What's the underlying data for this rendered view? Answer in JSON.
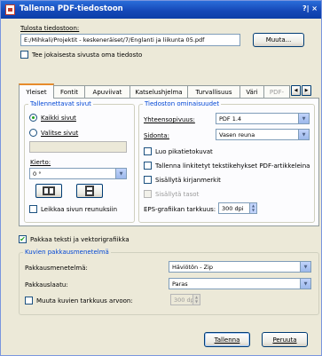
{
  "window": {
    "title": "Tallenna PDF-tiedostoon",
    "title_buttons": "?| ×"
  },
  "output": {
    "label": "Tulosta tiedostoon:",
    "path": "E:/Mihkali/Projektit - keskeneräiset/7/Englanti ja liikunta 05.pdf",
    "browse_button": "Muuta...",
    "separate_pages_label": "Tee jokaisesta sivusta oma tiedosto",
    "separate_pages_checked": false
  },
  "tabs": [
    {
      "label": "Yleiset",
      "active": true
    },
    {
      "label": "Fontit",
      "active": false
    },
    {
      "label": "Apuviivat",
      "active": false
    },
    {
      "label": "Katselushjelma",
      "active": false
    },
    {
      "label": "Turvallisuus",
      "active": false
    },
    {
      "label": "Väri",
      "active": false
    },
    {
      "label": "PDF-",
      "active": false
    }
  ],
  "pages_group": {
    "title": "Tallennettavat sivut",
    "all_pages_label": "Kaikki sivut",
    "all_pages_selected": true,
    "select_pages_label": "Valitse sivut",
    "select_pages_selected": false,
    "rotation_label": "Kierto:",
    "rotation_value": "0 °",
    "crop_label": "Leikkaa sivun reunuksiin"
  },
  "file_group": {
    "title": "Tiedoston ominaisuudet",
    "compat_label": "Yhteensopivuus:",
    "compat_value": "PDF 1.4",
    "binding_label": "Sidonta:",
    "binding_value": "Vasen reuna",
    "thumbnails_label": "Luo pikatietokuvat",
    "articles_label": "Tallenna linkitetyt tekstikehykset PDF-artikkeleina",
    "bookmarks_label": "Sisällytä kirjanmerkit",
    "layers_label": "Sisällytä tasot",
    "eps_label": "EPS-grafiikan tarkkuus:",
    "eps_value": "300 dpi"
  },
  "compress_text": {
    "label": "Pakkaa teksti ja vektorigrafiikka",
    "checked": true
  },
  "image_compression": {
    "title": "Kuvien pakkausmenetelmä",
    "method_label": "Pakkausmenetelmä:",
    "method_value": "Häviötön - Zip",
    "quality_label": "Pakkauslaatu:",
    "quality_value": "Paras",
    "resample_label": "Muuta kuvien tarkkuus arvoon:",
    "resample_value": "300 dpi"
  },
  "footer": {
    "save_button": "Tallenna",
    "cancel_button": "Peruuta"
  },
  "colors": {
    "titlebar": "#0c3ea7",
    "dialog_bg": "#ece9d8",
    "group_title": "#0046d5",
    "checkmark": "#21a121"
  }
}
